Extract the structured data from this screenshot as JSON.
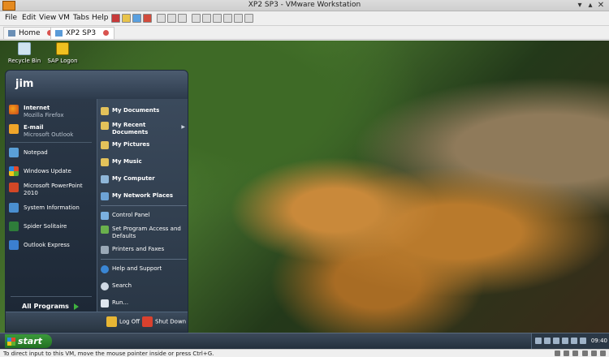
{
  "window": {
    "title": "XP2 SP3 - VMware Workstation"
  },
  "menubar": {
    "items": [
      "File",
      "Edit",
      "View",
      "VM",
      "Tabs",
      "Help"
    ]
  },
  "tabs": [
    {
      "label": "Home"
    },
    {
      "label": "XP2 SP3"
    }
  ],
  "desktop": {
    "icons": [
      {
        "label": "Recycle Bin"
      },
      {
        "label": "SAP Logon"
      }
    ]
  },
  "start_menu": {
    "user": "jim",
    "left_pinned": [
      {
        "title": "Internet",
        "subtitle": "Mozilla Firefox"
      },
      {
        "title": "E-mail",
        "subtitle": "Microsoft Outlook"
      }
    ],
    "left_recent": [
      {
        "label": "Notepad"
      },
      {
        "label": "Windows Update"
      },
      {
        "label": "Microsoft PowerPoint 2010"
      },
      {
        "label": "System Information"
      },
      {
        "label": "Spider Solitaire"
      },
      {
        "label": "Outlook Express"
      }
    ],
    "all_programs": "All Programs",
    "right_items": [
      {
        "label": "My Documents"
      },
      {
        "label": "My Recent Documents"
      },
      {
        "label": "My Pictures"
      },
      {
        "label": "My Music"
      },
      {
        "label": "My Computer"
      },
      {
        "label": "My Network Places"
      },
      {
        "label": "Control Panel"
      },
      {
        "label": "Set Program Access and Defaults"
      },
      {
        "label": "Printers and Faxes"
      },
      {
        "label": "Help and Support"
      },
      {
        "label": "Search"
      },
      {
        "label": "Run..."
      }
    ],
    "log_off": "Log Off",
    "shut_down": "Shut Down"
  },
  "taskbar": {
    "start_label": "start",
    "clock": "09:40"
  },
  "status_bar": {
    "text": "To direct input to this VM, move the mouse pointer inside or press Ctrl+G."
  }
}
